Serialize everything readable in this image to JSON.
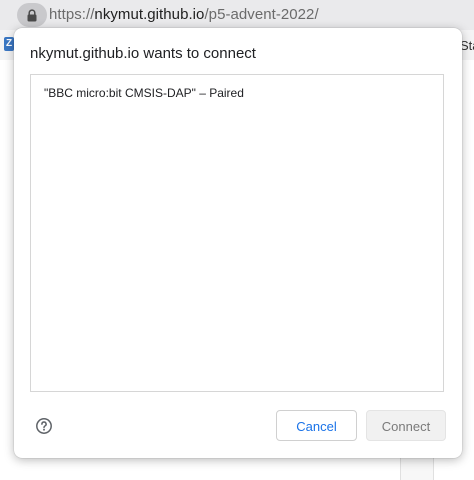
{
  "browser": {
    "url_scheme": "https://",
    "url_host": "nkymut.github.io",
    "url_path": "/p5-advent-2022/",
    "bg_tab_text": "Star",
    "bg_favicon_letter": "Z"
  },
  "dialog": {
    "title": "nkymut.github.io wants to connect",
    "devices": [
      {
        "label": "\"BBC micro:bit CMSIS-DAP\" – Paired"
      }
    ],
    "cancel_label": "Cancel",
    "connect_label": "Connect"
  },
  "colors": {
    "accent": "#1a73e8",
    "disabled_text": "#7a7a7a"
  }
}
